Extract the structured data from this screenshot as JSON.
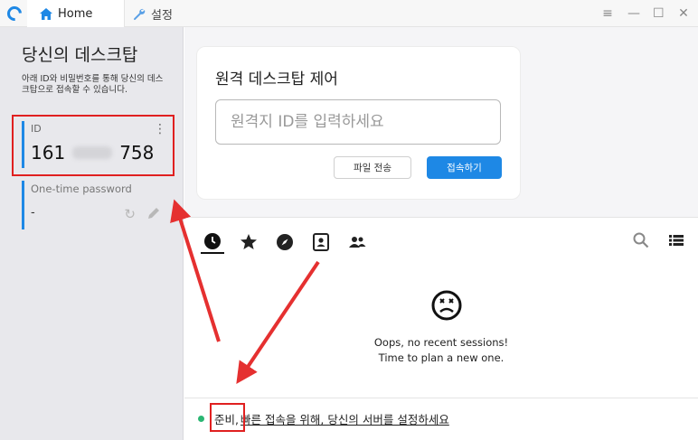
{
  "titlebar": {
    "tabs": [
      {
        "label": "Home",
        "icon": "home-icon"
      },
      {
        "label": "설정",
        "icon": "wrench-icon"
      }
    ],
    "window_controls": [
      "menu",
      "minimize",
      "maximize",
      "close"
    ]
  },
  "left": {
    "title": "당신의 데스크탑",
    "description": "아래 ID와 비밀번호를 통해 당신의 데스크탑으로 접속할 수 있습니다.",
    "id_label": "ID",
    "id_prefix": "161",
    "id_suffix": "758",
    "password_label": "One-time password",
    "password_value": "-"
  },
  "connect": {
    "title": "원격 데스크탑 제어",
    "input_placeholder": "원격지 ID를 입력하세요",
    "transfer_button": "파일 전송",
    "connect_button": "접속하기"
  },
  "sessions": {
    "tabs": [
      "recent-icon",
      "star-icon",
      "compass-icon",
      "address-book-icon",
      "group-icon"
    ],
    "empty_line1": "Oops, no recent sessions!",
    "empty_line2": "Time to plan a new one."
  },
  "status": {
    "ready_label": "준비,",
    "message": "빠른 접속을 위해, 당신의 서버를 설정하세요"
  },
  "colors": {
    "accent": "#1e88e5",
    "annotation": "#e02020",
    "status_ok": "#2bb673"
  }
}
